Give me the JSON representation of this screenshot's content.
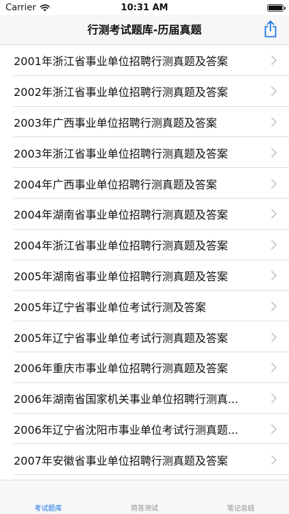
{
  "status_bar": {
    "carrier": "Carrier",
    "time": "10:31 AM"
  },
  "nav": {
    "title": "行测考试题库-历届真题",
    "share_icon": "share-icon",
    "accent_color": "#1a73e8"
  },
  "list": {
    "items": [
      {
        "label": "2001年浙江省事业单位招聘行测真题及答案"
      },
      {
        "label": "2002年浙江省事业单位招聘行测真题及答案"
      },
      {
        "label": "2003年广西事业单位招聘行测真题及答案"
      },
      {
        "label": "2003年浙江省事业单位招聘行测真题及答案"
      },
      {
        "label": "2004年广西事业单位招聘行测真题及答案"
      },
      {
        "label": "2004年湖南省事业单位招聘行测真题及答案"
      },
      {
        "label": "2004年浙江省事业单位招聘行测真题及答案"
      },
      {
        "label": "2005年湖南省事业单位招聘行测真题及答案"
      },
      {
        "label": "2005年辽宁省事业单位考试行测及答案"
      },
      {
        "label": "2005年辽宁省事业单位考试行测真题及答案"
      },
      {
        "label": "2006年重庆市事业单位招聘行测真题及答案"
      },
      {
        "label": "2006年湖南省国家机关事业单位招聘行测真..."
      },
      {
        "label": "2006年辽宁省沈阳市事业单位考试行测真题..."
      },
      {
        "label": "2007年安徽省事业单位招聘行测真题及答案"
      }
    ]
  },
  "tab_bar": {
    "tabs": [
      {
        "label": "考试题库",
        "active": true
      },
      {
        "label": "简答测试",
        "active": false
      },
      {
        "label": "笔记总结",
        "active": false
      }
    ]
  }
}
